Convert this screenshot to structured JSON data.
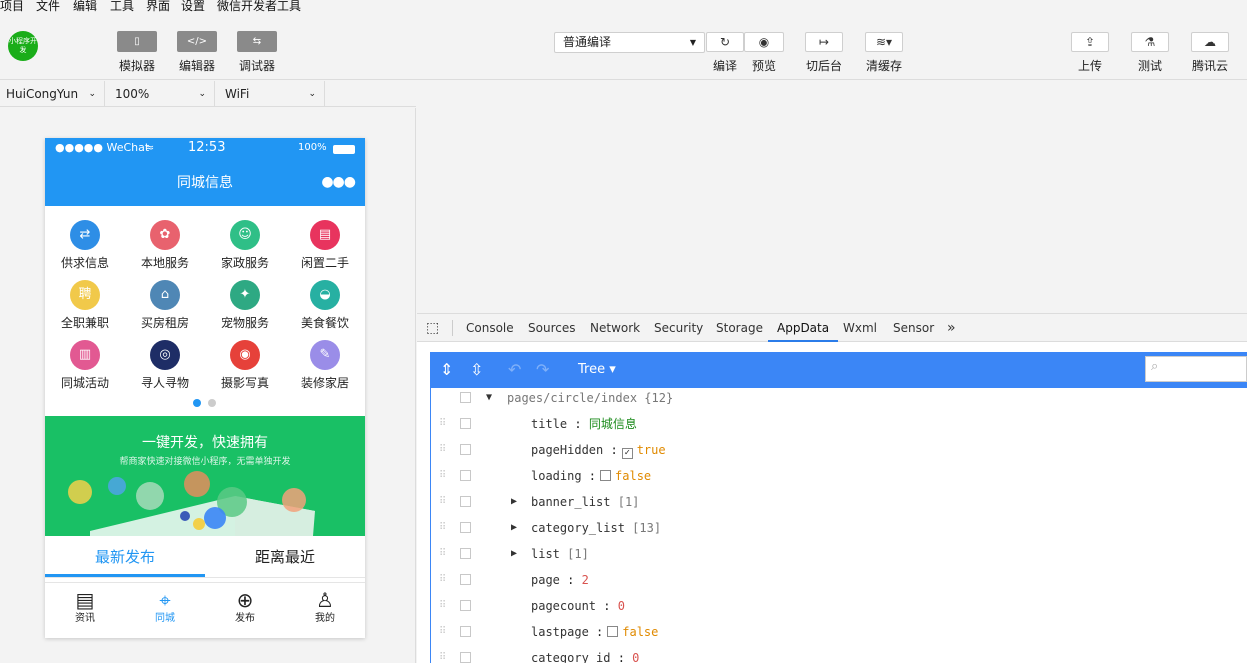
{
  "menu": [
    "项目",
    "文件",
    "编辑",
    "工具",
    "界面",
    "设置",
    "微信开发者工具"
  ],
  "toolbar": {
    "logo_text": "小程序开发",
    "simulator": "模拟器",
    "editor": "编辑器",
    "debugger": "调试器",
    "compile_mode": "普通编译",
    "compile": "编译",
    "preview": "预览",
    "background": "切后台",
    "clear_cache": "清缓存",
    "upload": "上传",
    "test": "测试",
    "cloud": "腾讯云"
  },
  "device": {
    "model": "HuiCongYun",
    "zoom": "100%",
    "network": "WiFi"
  },
  "phone": {
    "carrier": "●●●●● WeChat",
    "time": "12:53",
    "battery": "100%",
    "title": "同城信息",
    "categories": [
      {
        "label": "供求信息",
        "color": "#2e8ee6",
        "glyph": "⇄"
      },
      {
        "label": "本地服务",
        "color": "#e8626e",
        "glyph": "✿"
      },
      {
        "label": "家政服务",
        "color": "#2fbf87",
        "glyph": "☺"
      },
      {
        "label": "闲置二手",
        "color": "#e8345e",
        "glyph": "▤"
      },
      {
        "label": "全职兼职",
        "color": "#f1c94a",
        "glyph": "聘"
      },
      {
        "label": "买房租房",
        "color": "#4f87b5",
        "glyph": "⌂"
      },
      {
        "label": "宠物服务",
        "color": "#2ea983",
        "glyph": "✦"
      },
      {
        "label": "美食餐饮",
        "color": "#27b0a2",
        "glyph": "◒"
      },
      {
        "label": "同城活动",
        "color": "#e25992",
        "glyph": "▥"
      },
      {
        "label": "寻人寻物",
        "color": "#1e2d66",
        "glyph": "◎"
      },
      {
        "label": "摄影写真",
        "color": "#e6413a",
        "glyph": "◉"
      },
      {
        "label": "装修家居",
        "color": "#9a8de8",
        "glyph": "✎"
      }
    ],
    "banner_title": "一键开发，快速拥有",
    "banner_sub": "帮商家快速对接微信小程序，无需单独开发",
    "tab_latest": "最新发布",
    "tab_nearest": "距离最近",
    "tabbar": [
      "资讯",
      "同城",
      "发布",
      "我的"
    ]
  },
  "devtools": {
    "tabs": [
      "Console",
      "Sources",
      "Network",
      "Security",
      "Storage",
      "AppData",
      "Wxml",
      "Sensor"
    ],
    "active_tab": "AppData",
    "more": "»",
    "view_mode": "Tree ▾",
    "root": "pages/circle/index",
    "root_count": "{12}",
    "rows": [
      {
        "key": "title",
        "value": "同城信息"
      },
      {
        "key": "pageHidden",
        "value": "true"
      },
      {
        "key": "loading",
        "value": "false"
      },
      {
        "key": "banner_list",
        "value": "[1]"
      },
      {
        "key": "category_list",
        "value": "[13]"
      },
      {
        "key": "list",
        "value": "[1]"
      },
      {
        "key": "page",
        "value": "2"
      },
      {
        "key": "pagecount",
        "value": "0"
      },
      {
        "key": "lastpage",
        "value": "false"
      },
      {
        "key": "category_id",
        "value": "0"
      }
    ]
  }
}
